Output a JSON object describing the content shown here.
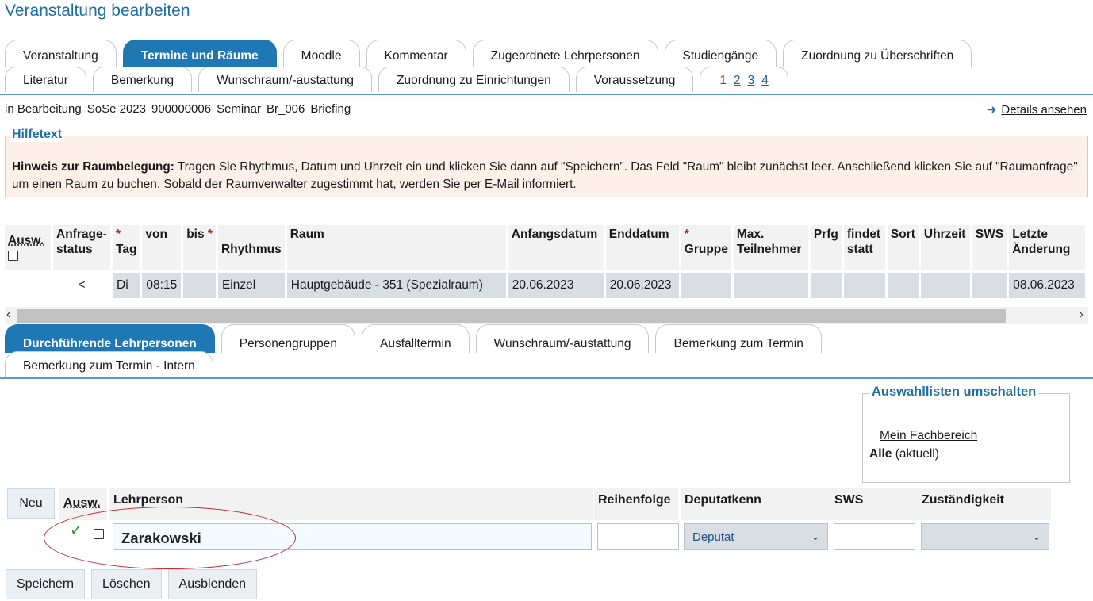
{
  "page": {
    "title": "Veranstaltung bearbeiten"
  },
  "main_tabs": {
    "row1": [
      "Veranstaltung",
      "Termine und Räume",
      "Moodle",
      "Kommentar",
      "Zugeordnete Lehrpersonen",
      "Studiengänge",
      "Zuordnung zu Überschriften"
    ],
    "row2": [
      "Literatur",
      "Bemerkung",
      "Wunschraum/-austattung",
      "Zuordnung zu Einrichtungen",
      "Voraussetzung"
    ],
    "active": "Termine und Räume",
    "pages": [
      "1",
      "2",
      "3",
      "4"
    ],
    "current_page": "1"
  },
  "info": {
    "status": "in Bearbeitung",
    "semester": "SoSe 2023",
    "number": "900000006",
    "type": "Seminar",
    "short": "Br_006",
    "name": "Briefing",
    "details_link": "Details ansehen"
  },
  "help": {
    "legend": "Hilfetext",
    "bold": "Hinweis zur Raumbelegung:",
    "text": " Tragen Sie Rhythmus, Datum und Uhrzeit ein und klicken Sie dann auf \"Speichern\". Das Feld \"Raum\" bleibt zunächst leer. Anschließend klicken Sie auf \"Raumanfrage\" um einen Raum zu buchen. Sobald der Raumverwalter zugestimmt hat, werden Sie per E-Mail informiert."
  },
  "appointments": {
    "headers": {
      "ausw": "Ausw.",
      "anfrage": [
        "Anfrage-",
        "status"
      ],
      "tag": "Tag",
      "von": "von",
      "bis": "bis",
      "rhythmus": "Rhythmus",
      "raum": "Raum",
      "anfangsdatum": "Anfangsdatum",
      "enddatum": "Enddatum",
      "gruppe": "Gruppe",
      "max": [
        "Max.",
        "Teilnehmer"
      ],
      "prfg": "Prfg",
      "findet": [
        "findet",
        "statt"
      ],
      "sort": "Sort",
      "uhrzeit": "Uhrzeit",
      "sws": "SWS",
      "letzte": [
        "Letzte",
        "Änderung"
      ],
      "required_mark": "*"
    },
    "rows": [
      {
        "anfrage": "<",
        "tag": "Di",
        "von": "08:15",
        "bis": "",
        "rhythmus": "Einzel",
        "raum": "Hauptgebäude - 351 (Spezialraum)",
        "anfangsdatum": "20.06.2023",
        "enddatum": "20.06.2023",
        "letzte": "08.06.2023"
      }
    ]
  },
  "sub_tabs": {
    "row1": [
      "Durchführende Lehrpersonen",
      "Personengruppen",
      "Ausfalltermin",
      "Wunschraum/-austattung",
      "Bemerkung zum Termin"
    ],
    "row2": [
      "Bemerkung zum Termin - Intern"
    ],
    "active": "Durchführende Lehrpersonen"
  },
  "switcher": {
    "legend": "Auswahllisten umschalten",
    "link": "Mein Fachbereich",
    "current_bold": "Alle",
    "current_suffix": " (aktuell)"
  },
  "teachers": {
    "new_button": "Neu",
    "headers": {
      "ausw": "Ausw.",
      "lehrperson": "Lehrperson",
      "reihenfolge": "Reihenfolge",
      "deputatkenn": "Deputatkenn",
      "sws": "SWS",
      "zustaendigkeit": "Zuständigkeit"
    },
    "rows": [
      {
        "name": "Zarakowski",
        "reihenfolge": "",
        "deputatkenn": "Deputat",
        "sws": "",
        "zustaendigkeit": ""
      }
    ]
  },
  "actions": {
    "save": "Speichern",
    "delete": "Löschen",
    "hide": "Ausblenden"
  },
  "colors": {
    "accent": "#1f78b4",
    "title": "#1f6fa3",
    "required": "#b3262d",
    "annotation": "#c0262d",
    "help_bg": "#fcf0e8"
  }
}
